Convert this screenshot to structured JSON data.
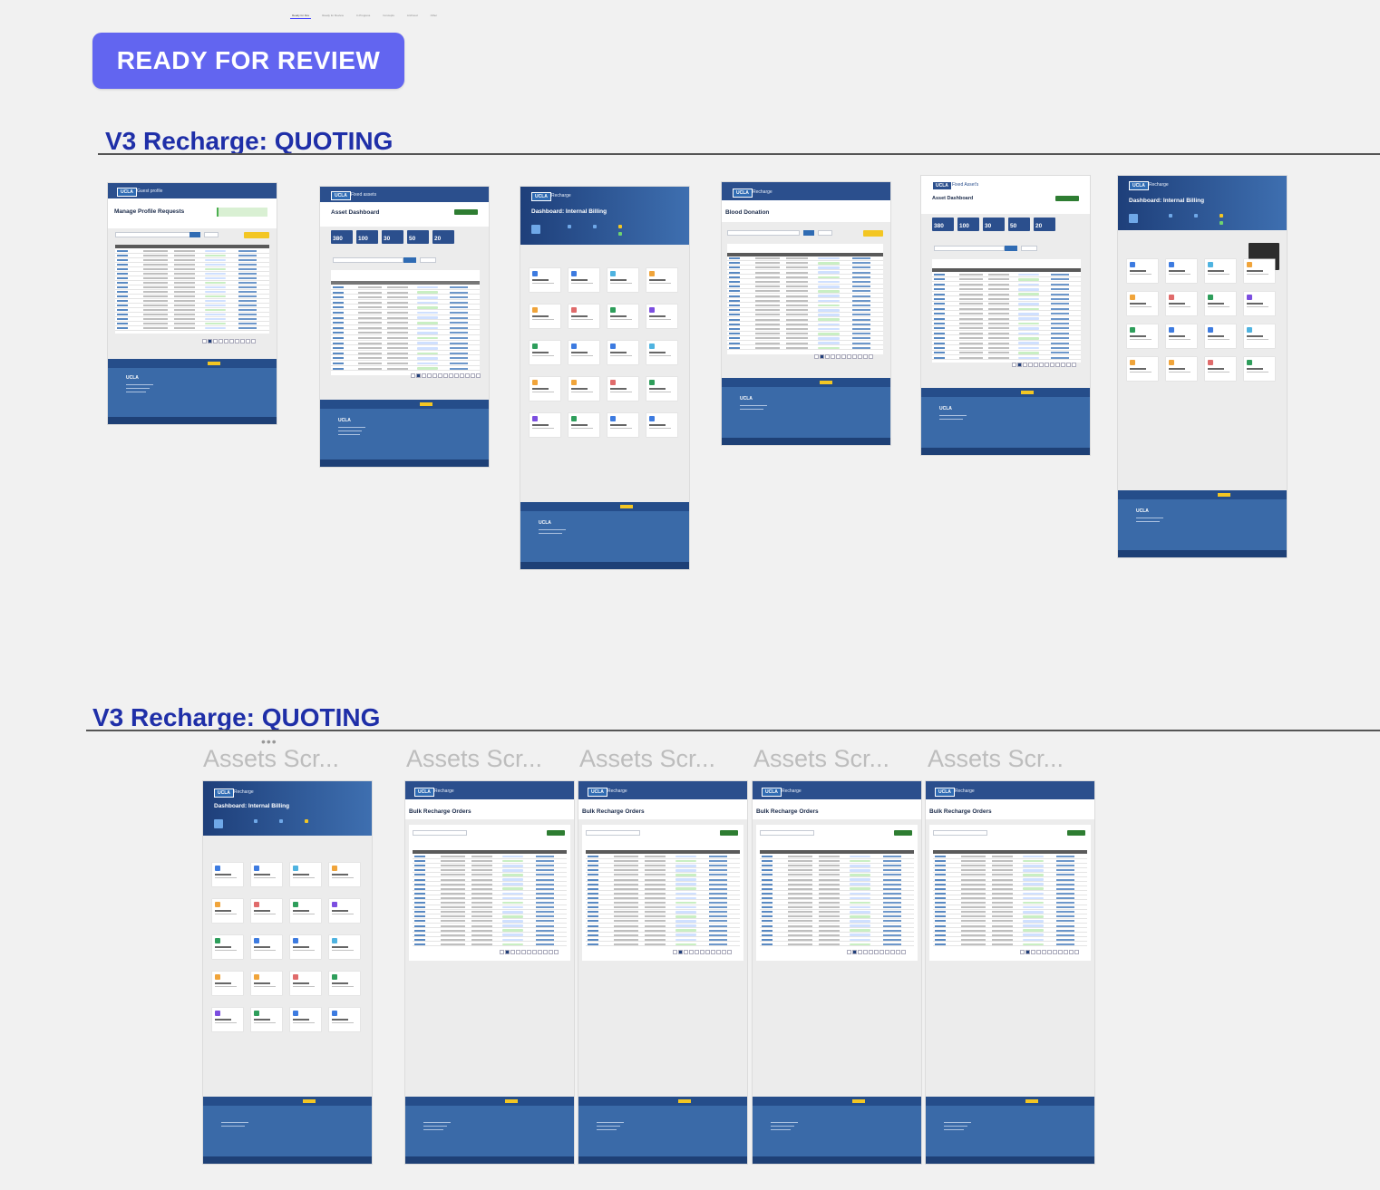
{
  "top_tabs": [
    "Ready for Dev",
    "Ready for Review",
    "In Progress",
    "Concepts",
    "Archived",
    "Other"
  ],
  "review_badge": "READY FOR REVIEW",
  "sections": [
    {
      "title": "V3 Recharge: QUOTING"
    },
    {
      "title": "V3 Recharge: QUOTING"
    }
  ],
  "frame_labels": [
    "Assets Scr...",
    "Assets Scr...",
    "Assets Scr...",
    "Assets Scr...",
    "Assets Scr..."
  ],
  "ucla": "UCLA",
  "row1": [
    {
      "app": "Guest profile",
      "title": "Manage Profile Requests",
      "stats": []
    },
    {
      "app": "Fixed assets",
      "title": "Asset Dashboard",
      "stats": [
        "380",
        "100",
        "30",
        "50",
        "20"
      ]
    },
    {
      "app": "Recharge",
      "title": "Dashboard: Internal Billing",
      "stats": []
    },
    {
      "app": "Recharge",
      "title": "Blood Donation",
      "stats": []
    },
    {
      "app": "Fixed Asset's",
      "title": "Asset Dashboard",
      "stats": [
        "380",
        "100",
        "30",
        "50",
        "20"
      ]
    },
    {
      "app": "Recharge",
      "title": "Dashboard: Internal Billing",
      "stats": []
    }
  ],
  "row2": [
    {
      "app": "Recharge",
      "title": "Dashboard: Internal Billing"
    },
    {
      "app": "Recharge",
      "title": "Bulk Recharge Orders"
    },
    {
      "app": "Recharge",
      "title": "Bulk Recharge Orders"
    },
    {
      "app": "Recharge",
      "title": "Bulk Recharge Orders"
    },
    {
      "app": "Recharge",
      "title": "Bulk Recharge Orders"
    }
  ],
  "colors": {
    "badge": "#6265f0",
    "section_title": "#1f2fa8",
    "header": "#2b4f8d",
    "footer": "#3a6aa8",
    "accent_yellow": "#f3c623"
  }
}
